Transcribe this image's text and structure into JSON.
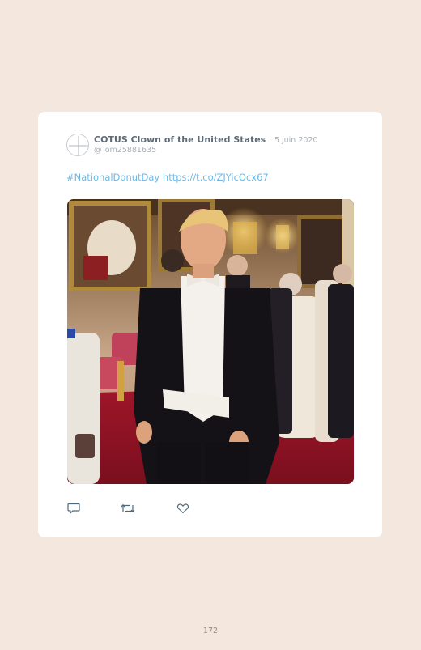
{
  "tweet": {
    "display_name": "COTUS Clown of the United States",
    "separator": "·",
    "date": "5 juin 2020",
    "handle": "@Tom25881635",
    "hashtag": "#NationalDonutDay",
    "link": "https://t.co/ZJYicOcx67"
  },
  "icons": {
    "reply": "reply-icon",
    "retweet": "retweet-icon",
    "like": "heart-icon"
  },
  "page": {
    "number": "172"
  },
  "colors": {
    "background": "#f3e7de",
    "card": "#ffffff",
    "link": "#6bb9e8",
    "name": "#5f6b77",
    "muted": "#a8b0b8"
  }
}
